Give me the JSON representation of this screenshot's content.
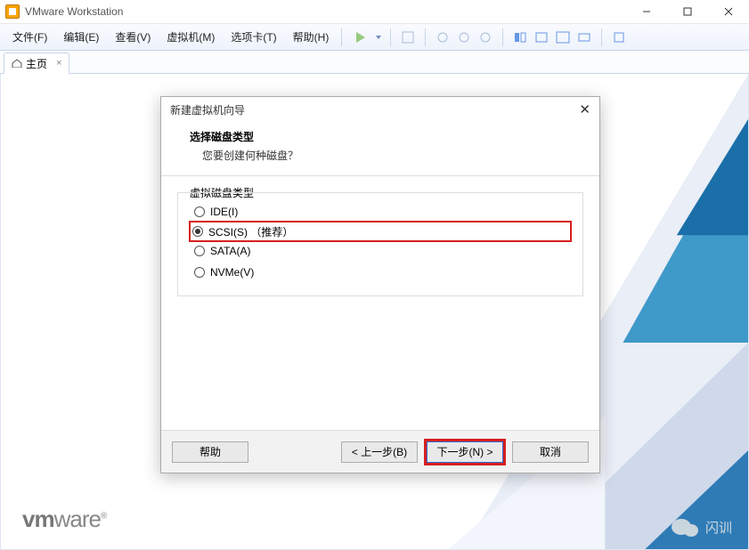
{
  "window": {
    "title": "VMware Workstation"
  },
  "menubar": {
    "items": [
      {
        "label": "文件(F)"
      },
      {
        "label": "编辑(E)"
      },
      {
        "label": "查看(V)"
      },
      {
        "label": "虚拟机(M)"
      },
      {
        "label": "选项卡(T)"
      },
      {
        "label": "帮助(H)"
      }
    ]
  },
  "tab": {
    "home_label": "主页"
  },
  "dialog": {
    "title": "新建虚拟机向导",
    "heading": "选择磁盘类型",
    "subheading": "您要创建何种磁盘？",
    "group_label": "虚拟磁盘类型",
    "options": [
      {
        "label": "IDE(I)",
        "checked": false,
        "highlight": false
      },
      {
        "label": "SCSI(S) （推荐）",
        "checked": true,
        "highlight": true
      },
      {
        "label": "SATA(A)",
        "checked": false,
        "highlight": false
      },
      {
        "label": "NVMe(V)",
        "checked": false,
        "highlight": false
      }
    ],
    "buttons": {
      "help": "帮助",
      "back": "< 上一步(B)",
      "next": "下一步(N) >",
      "cancel": "取消"
    }
  },
  "branding": {
    "vmware": "vmware",
    "watermark": "闪训"
  }
}
